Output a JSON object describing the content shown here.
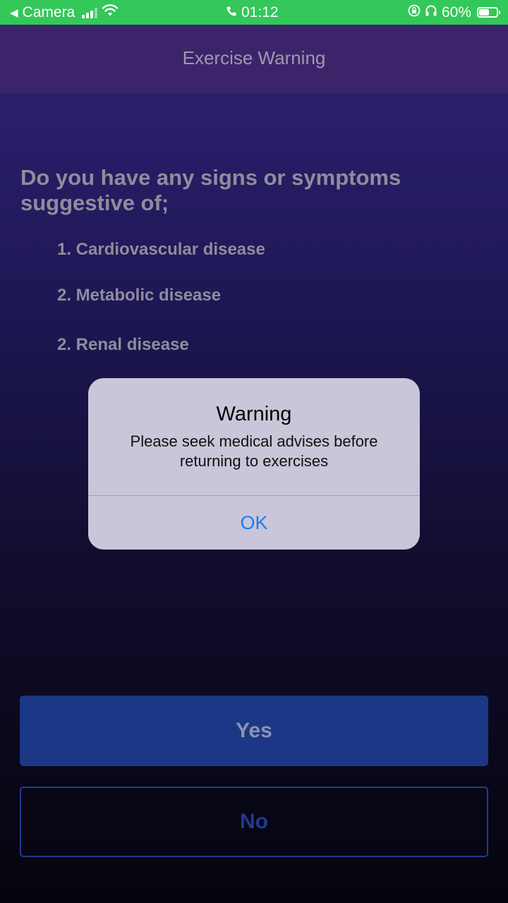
{
  "status_bar": {
    "back_app": "Camera",
    "time": "01:12",
    "battery_percent": "60%",
    "battery_level": 0.6
  },
  "header": {
    "title": "Exercise Warning"
  },
  "content": {
    "question": "Do you have any signs or symptoms suggestive of;",
    "items": [
      "1. Cardiovascular disease",
      "2. Metabolic disease",
      "2. Renal disease"
    ]
  },
  "buttons": {
    "yes_label": "Yes",
    "no_label": "No"
  },
  "alert": {
    "title": "Warning",
    "message": "Please seek medical advises before returning to exercises",
    "ok_label": "OK"
  },
  "colors": {
    "status_bar": "#34c759",
    "nav_bar": "#3c246b",
    "yes_button": "#1b3786",
    "no_button_border": "#1e3b8c",
    "alert_background": "#c8c6d8",
    "alert_action": "#1d7cf2"
  }
}
